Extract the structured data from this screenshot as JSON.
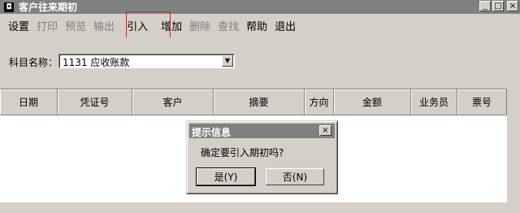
{
  "window": {
    "title": "客户往来期初",
    "controls": {
      "minimize": "_",
      "maximize": "□",
      "close": "×"
    }
  },
  "menu": {
    "items": [
      {
        "label": "设置",
        "enabled": true
      },
      {
        "label": "打印",
        "enabled": false
      },
      {
        "label": "预览",
        "enabled": false
      },
      {
        "label": "输出",
        "enabled": false
      },
      {
        "label": "引入",
        "enabled": true,
        "highlighted": true
      },
      {
        "label": "增加",
        "enabled": true
      },
      {
        "label": "删除",
        "enabled": false
      },
      {
        "label": "查找",
        "enabled": false
      },
      {
        "label": "帮助",
        "enabled": true
      },
      {
        "label": "退出",
        "enabled": true
      }
    ]
  },
  "filter": {
    "label": "科目名称：",
    "value": "1131 应收账款"
  },
  "table": {
    "columns": [
      "日期",
      "凭证号",
      "客户",
      "摘要",
      "方向",
      "金额",
      "业务员",
      "票号"
    ],
    "rows": []
  },
  "dialog": {
    "title": "提示信息",
    "message": "确定要引入期初吗?",
    "yes_label": "是(Y)",
    "no_label": "否(N)"
  },
  "colors": {
    "highlight_border": "#e02020",
    "title_bar": "#808080",
    "face": "#d4d0c8"
  }
}
